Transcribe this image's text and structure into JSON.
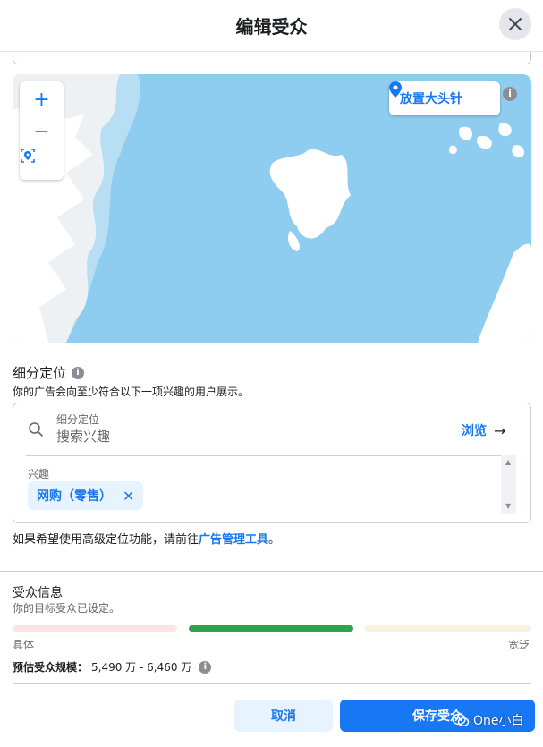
{
  "header": {
    "title": "编辑受众"
  },
  "map": {
    "place_pin_label": "放置大头针",
    "zoom_in": "+",
    "zoom_out": "−"
  },
  "detailed_targeting": {
    "title": "细分定位",
    "description": "你的广告会向至少符合以下一项兴趣的用户展示。",
    "search_label": "细分定位",
    "search_placeholder": "搜索兴趣",
    "browse_label": "浏览",
    "interests_label": "兴趣",
    "interests": [
      {
        "label": "网购（零售）"
      }
    ],
    "advanced_note_prefix": "如果希望使用高级定位功能，请前往",
    "advanced_note_link": "广告管理工具",
    "advanced_note_suffix": "。"
  },
  "audience_info": {
    "title": "受众信息",
    "description": "你的目标受众已设定。",
    "meter_low": "具体",
    "meter_high": "宽泛",
    "meter_state": "middle",
    "estimate_label": "预估受众规模：",
    "estimate_value": "5,490 万 - 6,460 万"
  },
  "footer": {
    "cancel_label": "取消",
    "save_label": "保存受众"
  },
  "watermark": {
    "text": "One小白"
  },
  "colors": {
    "accent": "#1877f2",
    "meter_left": "#fbe3e6",
    "meter_middle": "#31a24c",
    "meter_right": "#fcf0e1",
    "map_water": "#8ecdf0"
  }
}
